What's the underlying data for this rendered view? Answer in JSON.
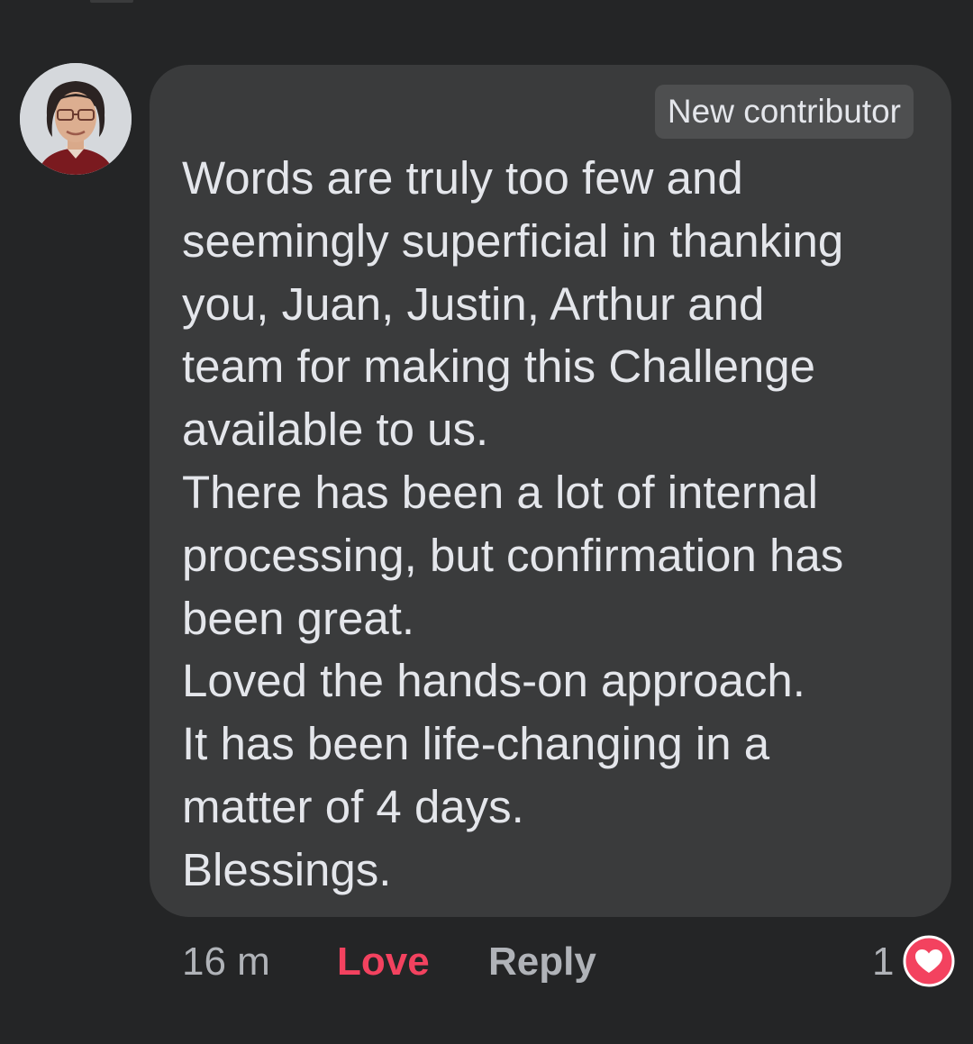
{
  "comment": {
    "badge": "New contributor",
    "lines": [
      "Words are truly too few and",
      "seemingly superficial in thanking",
      "you, Juan, Justin, Arthur and",
      "team for making this Challenge",
      "available to us.",
      "There has been a lot of internal",
      "processing, but confirmation has",
      "been great.",
      "Loved the hands-on approach.",
      "It has been life-changing in a",
      "matter of 4 days.",
      "Blessings."
    ],
    "timestamp": "16 m",
    "love_label": "Love",
    "reply_label": "Reply",
    "reaction_count": "1",
    "reaction_icon": "heart-icon"
  },
  "colors": {
    "background": "#242526",
    "bubble": "#3a3b3c",
    "badge": "#4e4f50",
    "text": "#e4e6eb",
    "secondary_text": "#b0b3b8",
    "love": "#f3425f"
  }
}
